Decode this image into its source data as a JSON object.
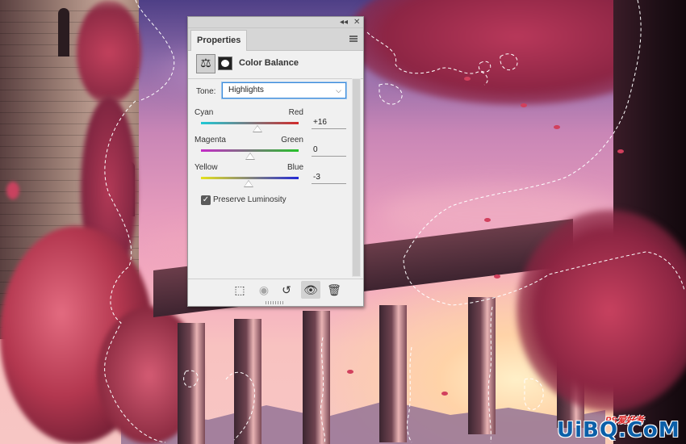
{
  "panel": {
    "tab_label": "Properties",
    "adjustment_name": "Color Balance",
    "adjustment_icon": "balance-scale-icon",
    "tone": {
      "label": "Tone:",
      "selected": "Highlights"
    },
    "sliders": [
      {
        "left": "Cyan",
        "right": "Red",
        "value": "+16",
        "level": 0.58,
        "gradient": [
          "#1fc9d6",
          "#d22b2b"
        ]
      },
      {
        "left": "Magenta",
        "right": "Green",
        "value": "0",
        "level": 0.5,
        "gradient": [
          "#c52bc8",
          "#26c22a"
        ]
      },
      {
        "left": "Yellow",
        "right": "Blue",
        "value": "-3",
        "level": 0.49,
        "gradient": [
          "#e5e21d",
          "#2329d6"
        ]
      }
    ],
    "preserve_luminosity": {
      "label": "Preserve Luminosity",
      "checked": true
    },
    "footer_icons": [
      "clip-to-layer-icon",
      "view-previous-state-icon",
      "reset-icon",
      "visibility-eye-icon",
      "delete-trash-icon"
    ]
  },
  "watermark": {
    "text": "UiBQ.CoM",
    "small": "PS爱好者"
  }
}
